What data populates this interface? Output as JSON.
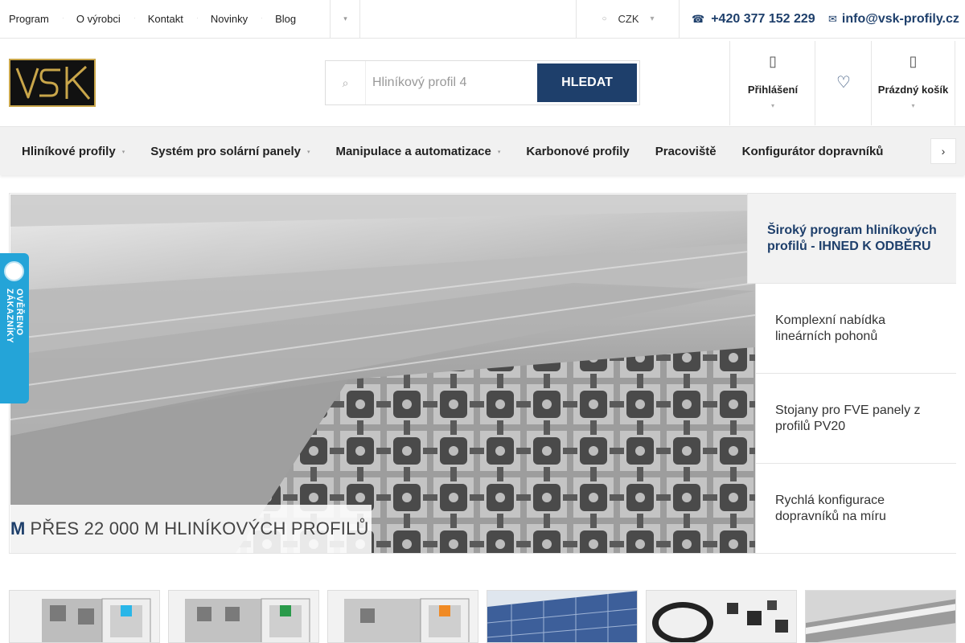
{
  "topnav": {
    "items": [
      "Program",
      "O výrobci",
      "Kontakt",
      "Novinky",
      "Blog"
    ]
  },
  "currency": {
    "value": "CZK"
  },
  "contact": {
    "phone": "+420 377 152 229",
    "email": "info@vsk-profily.cz"
  },
  "search": {
    "placeholder": "Hliníkový profil 4",
    "button": "HLEDAT"
  },
  "header": {
    "login_label": "Přihlášení",
    "cart_label": "Prázdný košík"
  },
  "mainnav": {
    "items": [
      {
        "label": "Hliníkové profily"
      },
      {
        "label": "Systém pro solární panely"
      },
      {
        "label": "Manipulace a automatizace"
      },
      {
        "label": "Karbonové profily"
      },
      {
        "label": "Pracoviště"
      },
      {
        "label": "Konfigurátor dopravníků"
      }
    ]
  },
  "hero": {
    "caption": "PŘES 22 000 M HLINÍKOVÝCH PROFILŮ",
    "slides": [
      "Široký program hliníkových profilů - IHNED K ODBĚRU",
      "Komplexní nabídka lineárních pohonů",
      "Stojany pro FVE panely z profilů PV20",
      "Rychlá konfigurace dopravníků na míru"
    ]
  },
  "badge": {
    "text": "OVĚŘENO ZÁKAZNÍKY"
  },
  "colors": {
    "brand": "#1e3f6b",
    "badge": "#24a4d8",
    "logo_gold": "#c9a64a"
  },
  "icons": {
    "phone": "phone-icon",
    "email": "envelope-icon",
    "search": "search-icon",
    "login": "user-icon",
    "wishlist": "heart-icon",
    "cart": "cart-icon",
    "nav_more": "chevron-right-icon"
  }
}
